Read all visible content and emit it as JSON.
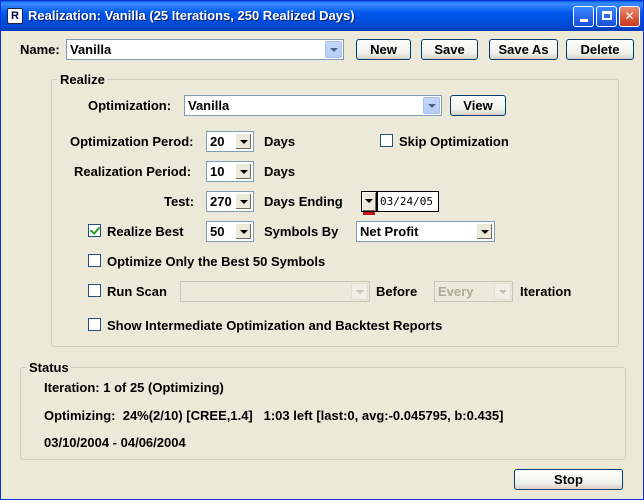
{
  "window": {
    "title": "Realization: Vanilla (25 Iterations, 250 Realized Days)",
    "app_icon": "R",
    "controls": [
      "minimize-icon",
      "maximize-icon",
      "close-icon"
    ]
  },
  "top": {
    "name_label": "Name:",
    "name_value": "Vanilla",
    "buttons": {
      "new": "New",
      "save": "Save",
      "save_as": "Save As",
      "delete": "Delete"
    }
  },
  "realize": {
    "group_title": "Realize",
    "optimization_label": "Optimization:",
    "optimization_value": "Vanilla",
    "view_button": "View",
    "opt_period_label": "Optimization Perod:",
    "opt_period_value": "20",
    "opt_period_unit": "Days",
    "skip_optimization_label": "Skip Optimization",
    "skip_optimization_checked": false,
    "real_period_label": "Realization Period:",
    "real_period_value": "10",
    "real_period_unit": "Days",
    "test_label": "Test:",
    "test_value": "270",
    "test_unit": "Days Ending",
    "test_end_date": "03/24/05",
    "realize_best_label": "Realize Best",
    "realize_best_checked": true,
    "realize_best_value": "50",
    "symbols_by_label": "Symbols By",
    "symbols_by_value": "Net Profit",
    "optimize_only_label": "Optimize Only the Best 50 Symbols",
    "optimize_only_checked": false,
    "run_scan_label": "Run Scan",
    "run_scan_checked": false,
    "run_scan_value": "",
    "before_label": "Before",
    "every_value": "Every",
    "iteration_label": "Iteration",
    "show_intermediate_label": "Show Intermediate Optimization and Backtest Reports",
    "show_intermediate_checked": false
  },
  "status": {
    "group_title": "Status",
    "iteration_line": "Iteration: 1 of 25 (Optimizing)",
    "optimizing_line": "Optimizing:  24%(2/10) [CREE,1.4]   1:03 left [last:0, avg:-0.045795, b:0.435]",
    "date_range": "03/10/2004 - 04/06/2004"
  },
  "stop_button": "Stop",
  "colors": {
    "title_bar": "#0058ee",
    "dialog_bg": "#ece9d8",
    "check_mark": "#21a121"
  }
}
